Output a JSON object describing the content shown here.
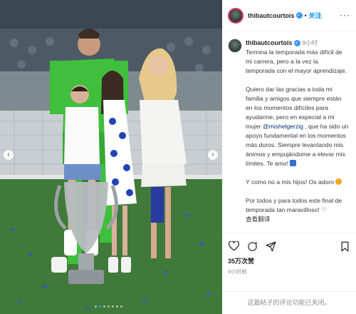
{
  "post": {
    "username": "thibautcourtois",
    "follow_label": "关注",
    "separator": "•",
    "time_ago": "9小时",
    "caption_1": "Termina la temporada más difícil de mi carrera, pero a la vez la temporada con el mayor aprendizaje.",
    "caption_2a": "Quiero dar las gracias a toda mi familia y amigos que siempre están en los momentos difíciles para ayudarme, pero en especial a mi mujer ",
    "mention": "@mishelgerzig",
    "caption_2b": " , que ha sido un apoyo fundamental en los momentos más duros. Siempre levantando mis ánimos y empujándome a elevar mis límites. Te amo! ",
    "caption_3": "Y como no a mis hijos! Os adoro ",
    "caption_4": "Por todos y para todos este final de temporada tan maravilloso! ♡",
    "caption_cutoff": "查看翻译",
    "likes": "35万次赞",
    "post_time": "9小时前",
    "comments_disabled": "这篇帖子的评论功能已关闭。"
  },
  "icons": {
    "more": "more-horizontal-icon",
    "like": "heart-icon",
    "comment": "comment-icon",
    "share": "share-icon",
    "save": "bookmark-icon",
    "prev": "chevron-left-icon",
    "next": "chevron-right-icon"
  },
  "colors": {
    "accent": "#0095f6",
    "verified": "#3897f0",
    "story_ring": "#e1306c"
  },
  "carousel": {
    "total": 7,
    "active": 1
  }
}
